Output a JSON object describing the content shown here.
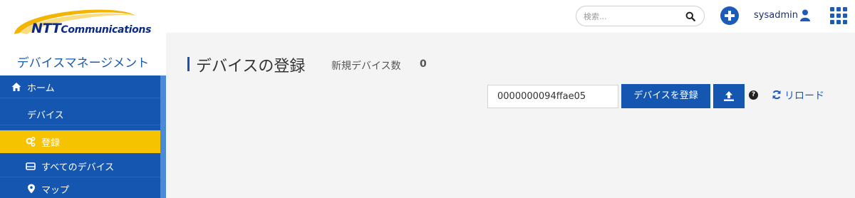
{
  "header": {
    "logo_text_ntt": "NTT",
    "logo_text_comm": "Communications",
    "search_placeholder": "検索...",
    "username": "sysadmin",
    "icons": {
      "search": "search-icon",
      "add": "plus-circle-icon",
      "user": "user-icon",
      "apps": "grid-icon"
    }
  },
  "sidebar": {
    "brand": "デバイスマネージメント",
    "items": [
      {
        "label": "ホーム",
        "icon": "home-icon",
        "active": false
      },
      {
        "label": "デバイス",
        "icon": "",
        "active": false
      },
      {
        "label": "登録",
        "icon": "cogs-icon",
        "active": true
      },
      {
        "label": "すべてのデバイス",
        "icon": "hdd-icon",
        "active": false
      },
      {
        "label": "マップ",
        "icon": "map-marker-icon",
        "active": false
      }
    ]
  },
  "main": {
    "title": "デバイスの登録",
    "subtitle": "新規デバイス数",
    "new_device_count": "0",
    "device_id_value": "0000000094ffae05",
    "register_button": "デバイスを登録",
    "upload_icon": "upload-icon",
    "help_icon": "question-circle-icon",
    "help_glyph": "?",
    "reload_label": "リロード",
    "reload_icon": "refresh-icon"
  },
  "colors": {
    "primary": "#1557b0",
    "accent_yellow": "#f6c300",
    "link_blue": "#1d5bb8",
    "content_bg": "#f4f4f4"
  }
}
